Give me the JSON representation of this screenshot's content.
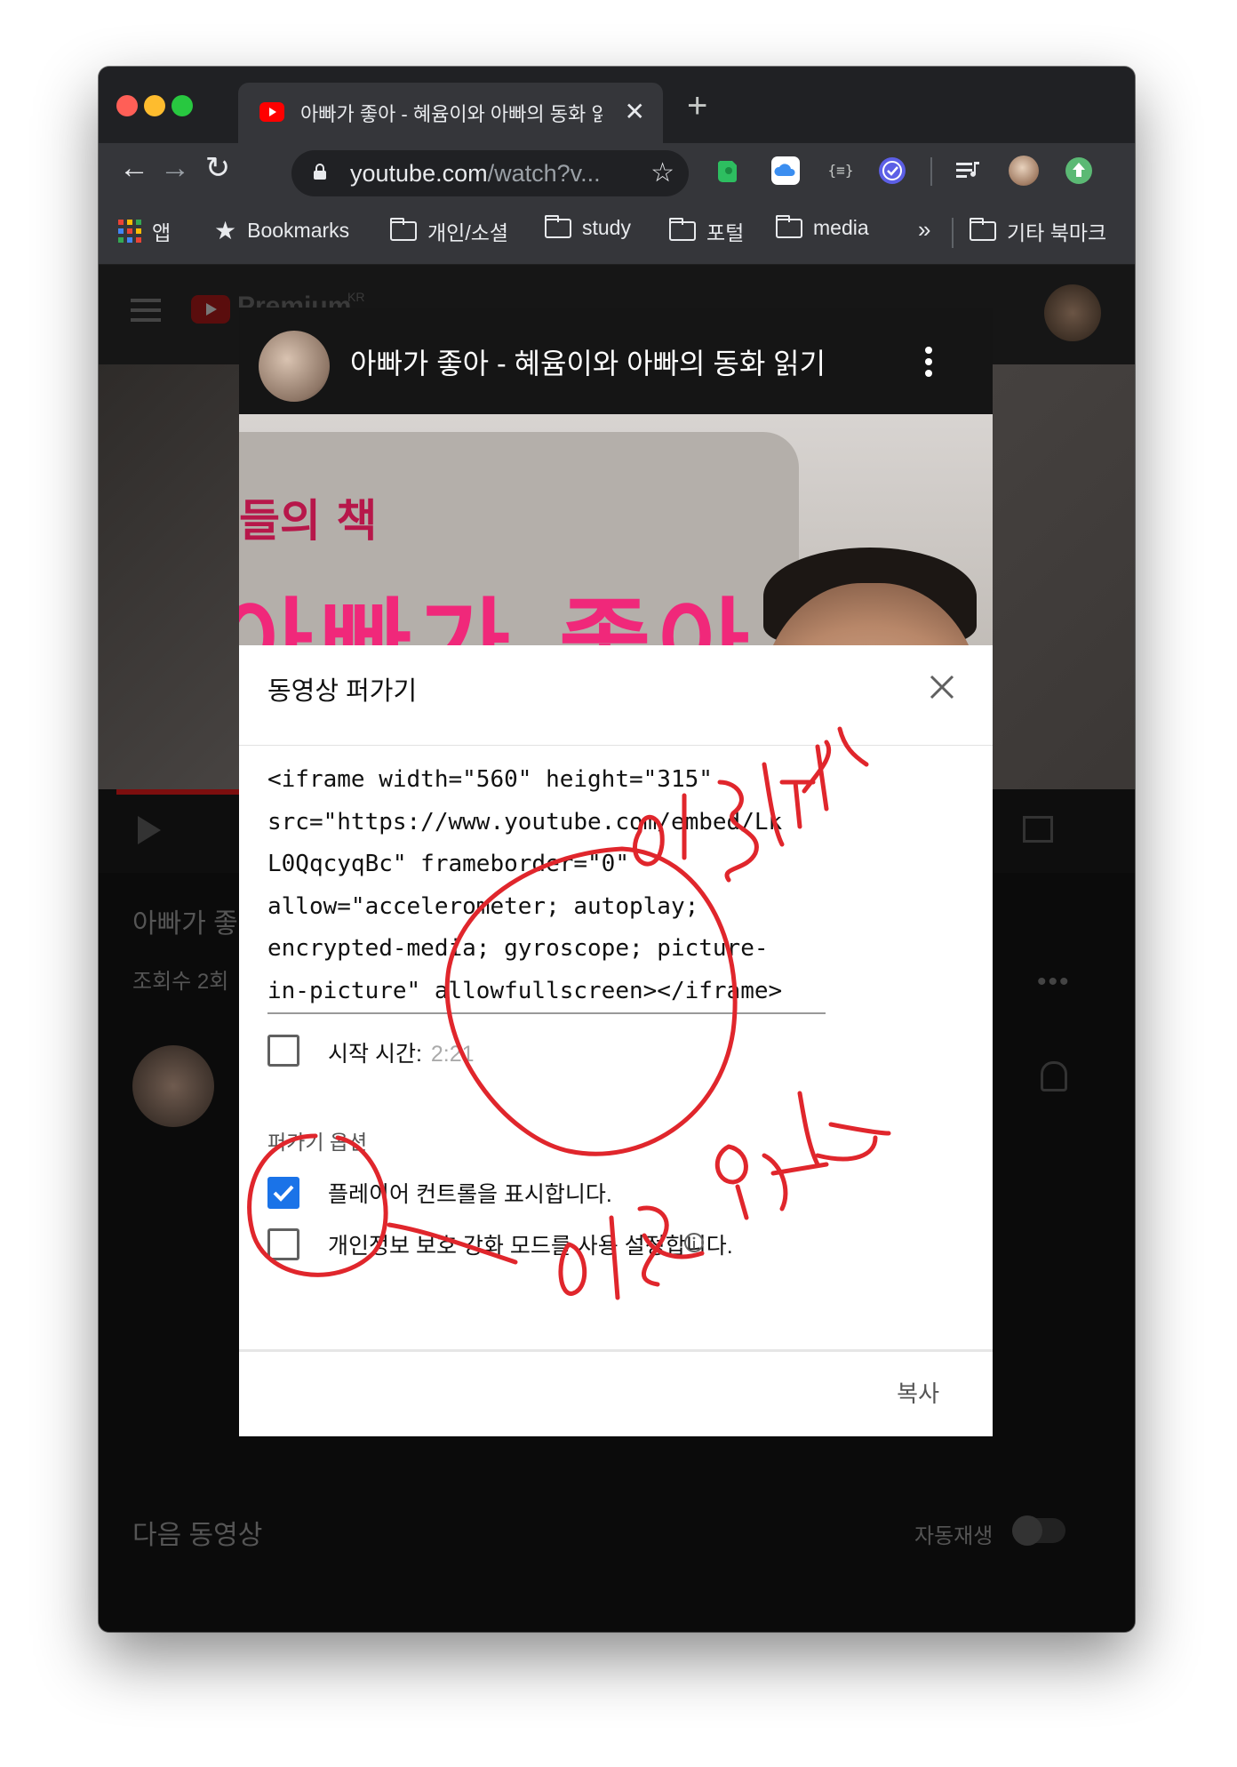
{
  "browser": {
    "tab_title": "아빠가 좋아 - 혜윰이와 아빠의 동화 읽기",
    "url_host": "youtube.com",
    "url_path": "/watch?v...",
    "bookmarks": [
      "앱",
      "Bookmarks",
      "개인/소셜",
      "study",
      "포털",
      "media"
    ],
    "overflow": "»",
    "other_bookmarks": "기타 북마크"
  },
  "background_page": {
    "brand": "Premium",
    "brand_region": "KR",
    "video_title_partial": "아빠가 좋",
    "views_partial": "조회수 2회",
    "up_next": "다음 동영상",
    "autoplay": "자동재생"
  },
  "modal": {
    "channel_title": "아빠가 좋아 - 혜윰이와 아빠의 동화 읽기",
    "thumbnail_text_small": "들의 책",
    "thumbnail_text_big": "아빠가 좋아",
    "heading": "동영상 퍼가기",
    "embed_code": "<iframe width=\"560\" height=\"315\"\nsrc=\"https://www.youtube.com/embed/Lk\nL0QqcyqBc\" frameborder=\"0\"\nallow=\"accelerometer; autoplay;\nencrypted-media; gyroscope; picture-\nin-picture\" allowfullscreen></iframe>",
    "start_time_label": "시작 시간:",
    "start_time_value": "2:21",
    "start_time_checked": false,
    "options_heading": "퍼가기 옵션",
    "options": [
      {
        "label": "플레이어 컨트롤을 표시합니다.",
        "checked": true
      },
      {
        "label": "개인정보 보호 강화 모드를 사용 설정합니다.",
        "checked": false
      }
    ],
    "copy_button": "복사"
  },
  "annotations": {
    "copy_note": "이걸복사",
    "option_note": "이건 옵션",
    "color": "#e0262c"
  },
  "colors": {
    "accent": "#1a73e8",
    "youtube_red": "#ff0000",
    "thumbnail_pink": "#f0287a"
  }
}
